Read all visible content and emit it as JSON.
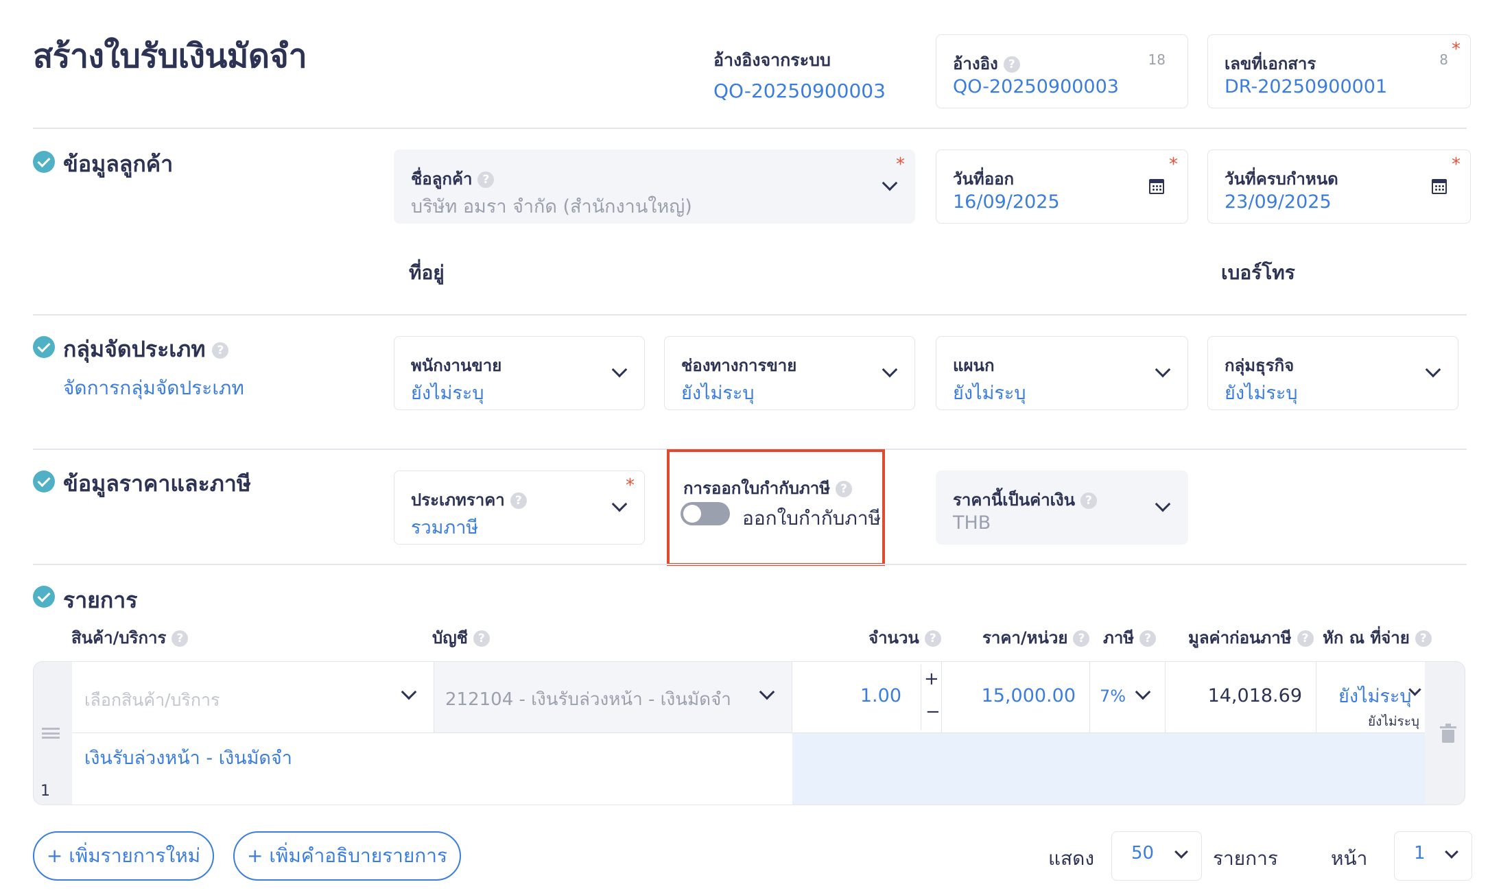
{
  "header": {
    "title": "สร้างใบรับเงินมัดจำ",
    "system_ref_label": "อ้างอิงจากระบบ",
    "system_ref_value": "QO-20250900003",
    "ref_label": "อ้างอิง",
    "ref_count": "18",
    "ref_value": "QO-20250900003",
    "docno_label": "เลขที่เอกสาร",
    "docno_count": "8",
    "docno_value": "DR-20250900001"
  },
  "customer": {
    "section_title": "ข้อมูลลูกค้า",
    "name_label": "ชื่อลูกค้า",
    "name_value": "บริษัท อมรา จำกัด (สำนักงานใหญ่)",
    "issue_date_label": "วันที่ออก",
    "issue_date_value": "16/09/2025",
    "due_date_label": "วันที่ครบกำหนด",
    "due_date_value": "23/09/2025",
    "address_label": "ที่อยู่",
    "phone_label": "เบอร์โทร"
  },
  "grouping": {
    "section_title": "กลุ่มจัดประเภท",
    "manage_link": "จัดการกลุ่มจัดประเภท",
    "fields": [
      {
        "label": "พนักงานขาย",
        "value": "ยังไม่ระบุ"
      },
      {
        "label": "ช่องทางการขาย",
        "value": "ยังไม่ระบุ"
      },
      {
        "label": "แผนก",
        "value": "ยังไม่ระบุ"
      },
      {
        "label": "กลุ่มธุรกิจ",
        "value": "ยังไม่ระบุ"
      }
    ]
  },
  "pricing": {
    "section_title": "ข้อมูลราคาและภาษี",
    "price_type_label": "ประเภทราคา",
    "price_type_value": "รวมภาษี",
    "tax_invoice_label": "การออกใบกำกับภาษี",
    "tax_invoice_toggle_text": "ออกใบกำกับภาษี",
    "tax_invoice_enabled": false,
    "currency_label": "ราคานี้เป็นค่าเงิน",
    "currency_value": "THB",
    "highlight_color": "#e04a2f"
  },
  "items": {
    "section_title": "รายการ",
    "columns": {
      "product": "สินค้า/บริการ",
      "account": "บัญชี",
      "qty": "จำนวน",
      "unit_price": "ราคา/หน่วย",
      "tax": "ภาษี",
      "pre_tax": "มูลค่าก่อนภาษี",
      "wht": "หัก ณ ที่จ่าย"
    },
    "rows": [
      {
        "index": "1",
        "product_placeholder": "เลือกสินค้า/บริการ",
        "account": "212104 - เงินรับล่วงหน้า - เงินมัดจำ",
        "qty": "1.00",
        "unit_price": "15,000.00",
        "tax": "7%",
        "pre_tax": "14,018.69",
        "wht": "ยังไม่ระบุ",
        "wht_sub": "ยังไม่ระบุ",
        "description": "เงินรับล่วงหน้า - เงินมัดจำ"
      }
    ],
    "add_item_button": "+ เพิ่มรายการใหม่",
    "add_description_button": "+ เพิ่มคำอธิบายรายการ",
    "show_label": "แสดง",
    "page_size": "50",
    "items_label": "รายการ",
    "page_label": "หน้า",
    "page_value": "1"
  }
}
